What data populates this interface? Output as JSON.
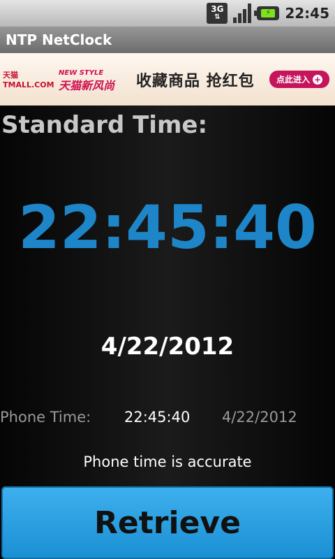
{
  "status_bar": {
    "network_label": "3G",
    "clock": "22:45"
  },
  "app": {
    "title": "NTP NetClock"
  },
  "ad": {
    "logo_text": "天猫 TMALL.COM",
    "style_text": "NEW STYLE",
    "brand_text": "天猫新风尚",
    "slogan": "收藏商品 抢红包",
    "button_label": "点此进入"
  },
  "clock": {
    "standard_label": "Standard Time:",
    "standard_time": "22:45:40",
    "standard_date": "4/22/2012",
    "phone_label": "Phone Time:",
    "phone_time": "22:45:40",
    "phone_date": "4/22/2012",
    "accuracy_message": "Phone time is accurate"
  },
  "actions": {
    "retrieve_label": "Retrieve"
  },
  "colors": {
    "accent_blue": "#1e86c8",
    "button_blue": "#2ea3e4"
  }
}
